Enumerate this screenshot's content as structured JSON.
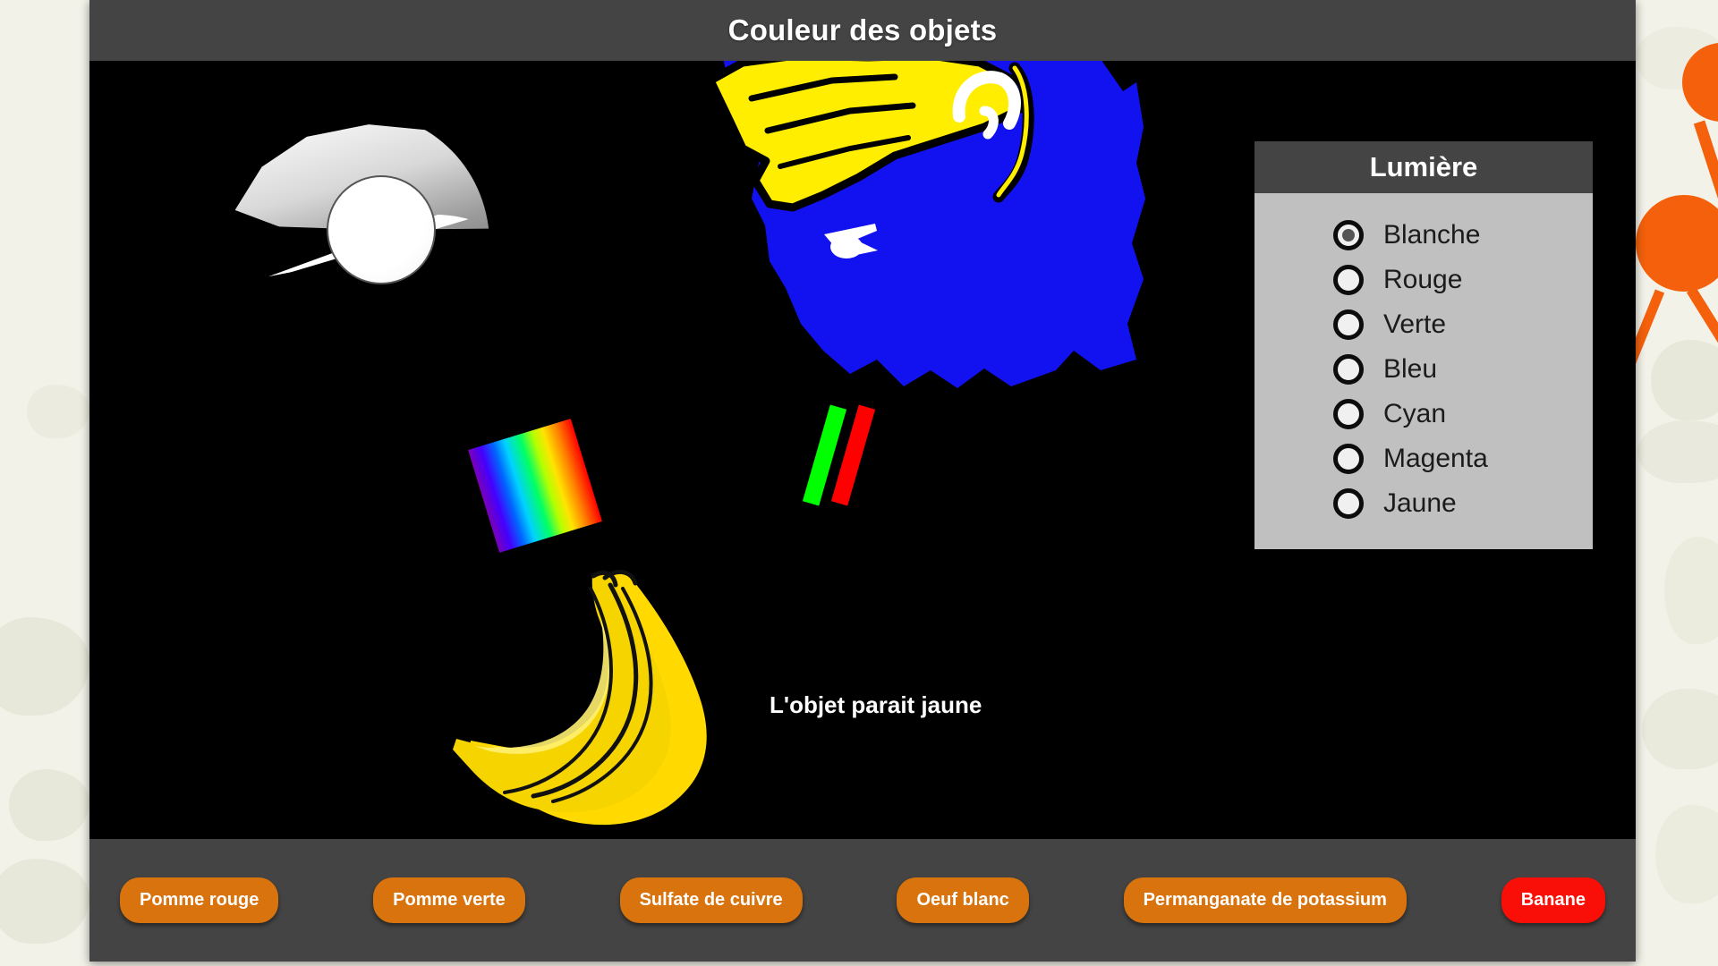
{
  "header": {
    "title": "Couleur des objets"
  },
  "stage": {
    "status_text": "L'objet parait jaune",
    "lamp": "desk-lamp",
    "objects": [
      "spectrum-strip",
      "green-red-bars",
      "character-head",
      "banana"
    ]
  },
  "light_panel": {
    "title": "Lumière",
    "selected": "Blanche",
    "options": [
      {
        "label": "Blanche",
        "selected": true
      },
      {
        "label": "Rouge",
        "selected": false
      },
      {
        "label": "Verte",
        "selected": false
      },
      {
        "label": "Bleu",
        "selected": false
      },
      {
        "label": "Cyan",
        "selected": false
      },
      {
        "label": "Magenta",
        "selected": false
      },
      {
        "label": "Jaune",
        "selected": false
      }
    ]
  },
  "object_buttons": [
    {
      "label": "Pomme rouge",
      "active": false
    },
    {
      "label": "Pomme verte",
      "active": false
    },
    {
      "label": "Sulfate de cuivre",
      "active": false
    },
    {
      "label": "Oeuf blanc",
      "active": false
    },
    {
      "label": "Permanganate de potassium",
      "active": false
    },
    {
      "label": "Banane",
      "active": true
    }
  ],
  "colors": {
    "page_bg": "#f2f2e9",
    "chrome": "#444444",
    "stage_bg": "#000000",
    "panel_bg": "#c0c0c0",
    "button": "#d9730d",
    "button_active": "#f90f07",
    "decor_orange": "#f4600b",
    "banana_yellow": "#ffe000",
    "character_blue": "#1212f0",
    "character_hair": "#ffee00"
  }
}
